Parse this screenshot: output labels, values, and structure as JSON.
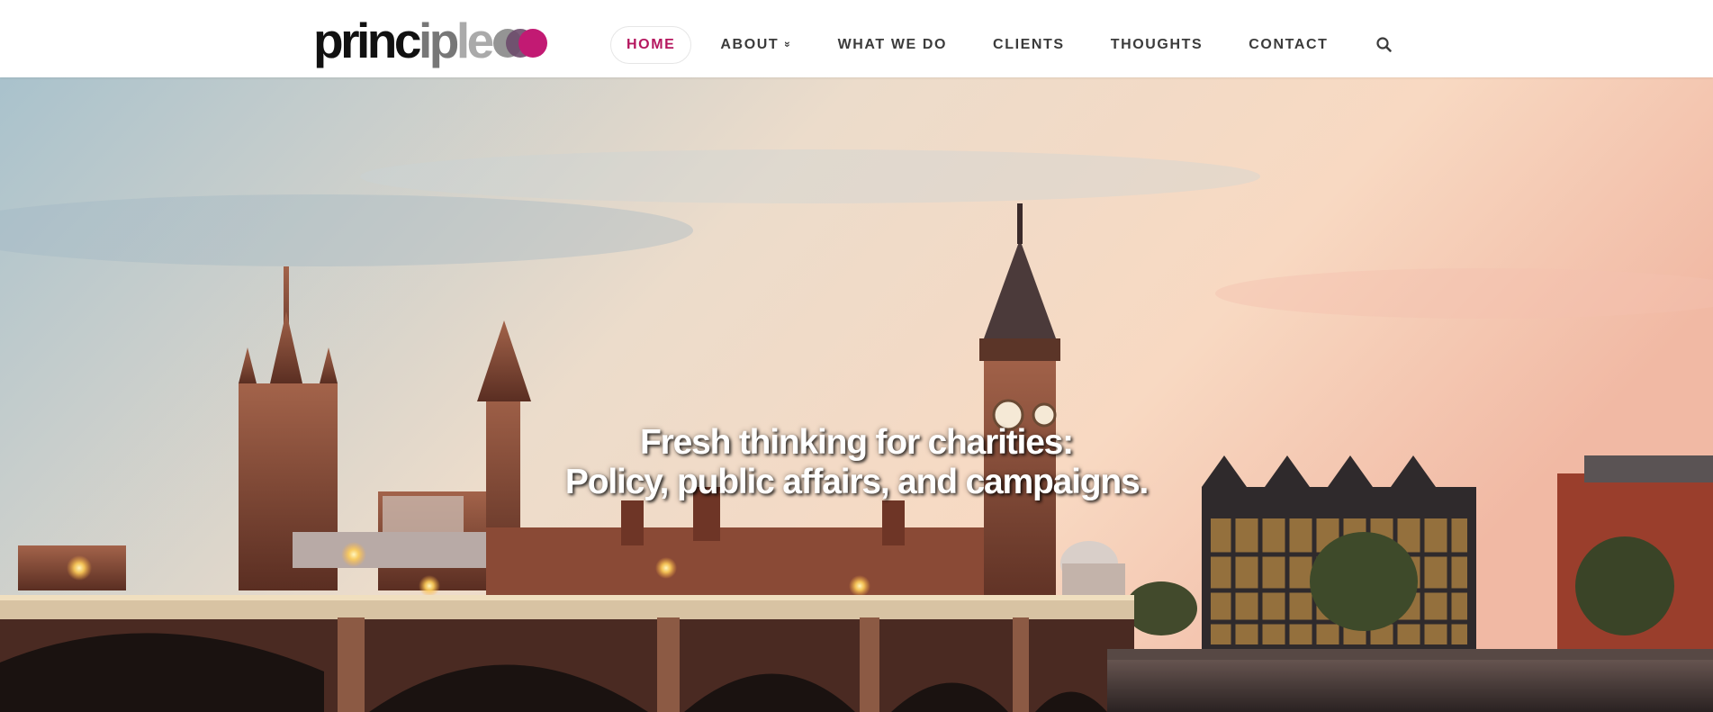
{
  "logo": {
    "part1": "princ",
    "part2": "ip",
    "part3": "le",
    "alt": "principle"
  },
  "nav": {
    "items": [
      {
        "label": "HOME",
        "active": true
      },
      {
        "label": "ABOUT",
        "has_dropdown": true
      },
      {
        "label": "WHAT WE DO"
      },
      {
        "label": "CLIENTS"
      },
      {
        "label": "THOUGHTS"
      },
      {
        "label": "CONTACT"
      }
    ],
    "dropdown_caret": "»"
  },
  "hero": {
    "line1": "Fresh thinking for charities:",
    "line2": "Policy, public affairs, and campaigns."
  },
  "colors": {
    "accent": "#b5175f",
    "nav_text": "#3b3b3b",
    "logo_dot": "#c21a73"
  },
  "icons": {
    "search": "search-icon",
    "dropdown": "chevron-down-icon"
  }
}
